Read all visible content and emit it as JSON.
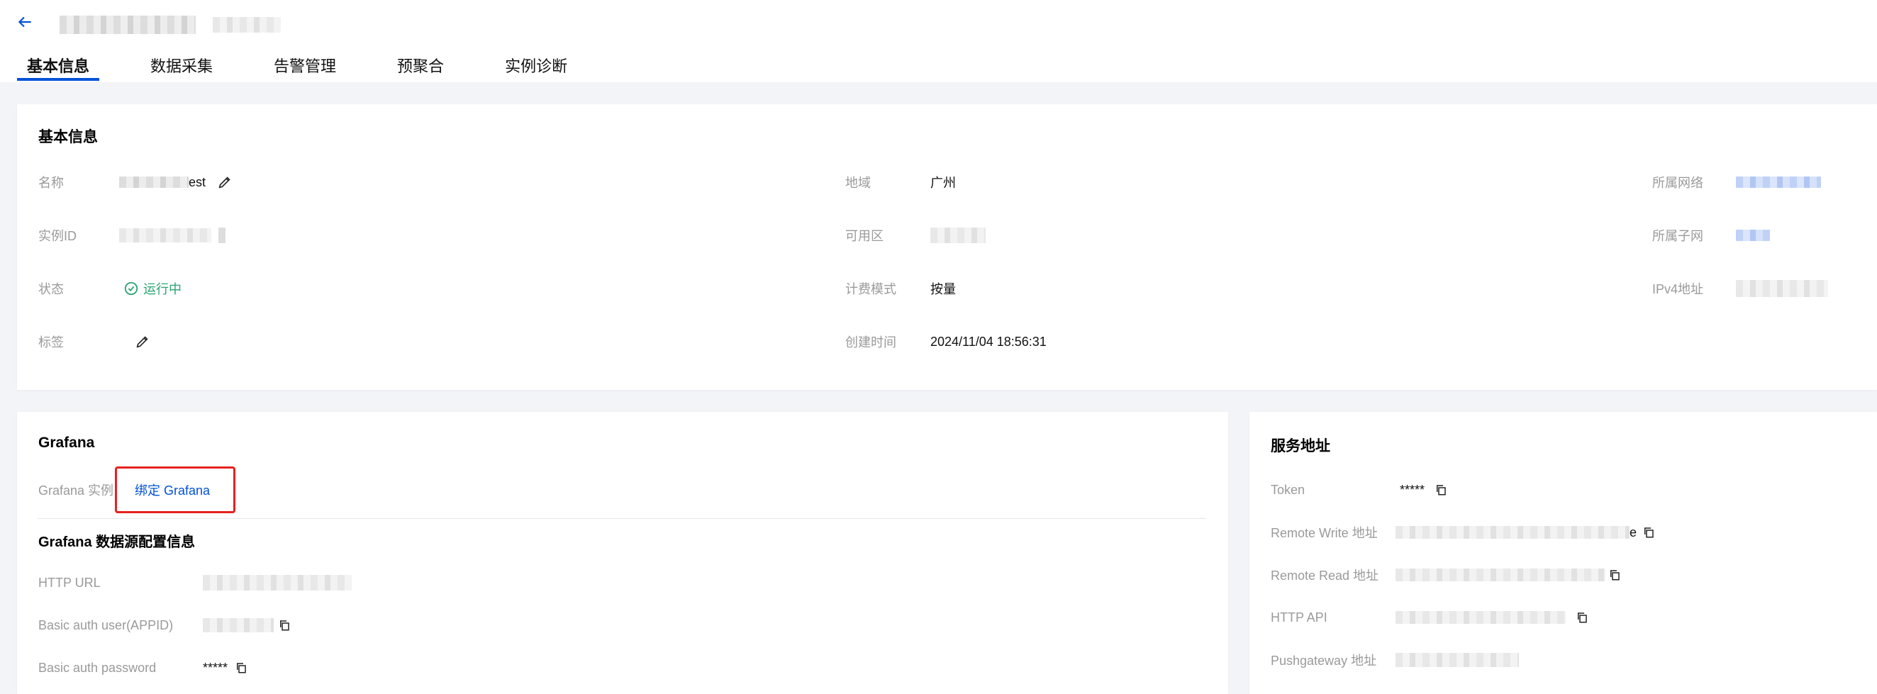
{
  "header": {
    "tabs": [
      {
        "label": "基本信息",
        "active": true
      },
      {
        "label": "数据采集"
      },
      {
        "label": "告警管理"
      },
      {
        "label": "预聚合"
      },
      {
        "label": "实例诊断"
      }
    ]
  },
  "basic": {
    "title": "基本信息",
    "name_label": "名称",
    "name_value_suffix": "est",
    "instance_id_label": "实例ID",
    "status_label": "状态",
    "status_value": "运行中",
    "tags_label": "标签",
    "region_label": "地域",
    "region_value": "广州",
    "zone_label": "可用区",
    "billing_label": "计费模式",
    "billing_value": "按量",
    "created_label": "创建时间",
    "created_value": "2024/11/04 18:56:31",
    "vpc_label": "所属网络",
    "subnet_label": "所属子网",
    "ipv4_label": "IPv4地址"
  },
  "grafana": {
    "title": "Grafana",
    "instance_label": "Grafana 实例",
    "bind_link": "绑定 Grafana",
    "ds_title": "Grafana 数据源配置信息",
    "http_url_label": "HTTP URL",
    "basic_user_label": "Basic auth user(APPID)",
    "basic_pwd_label": "Basic auth password",
    "basic_pwd_value": "*****"
  },
  "service": {
    "title": "服务地址",
    "token_label": "Token",
    "token_value": "*****",
    "remote_write_label": "Remote Write 地址",
    "remote_write_suffix": "e",
    "remote_read_label": "Remote Read 地址",
    "http_api_label": "HTTP API",
    "pushgateway_label": "Pushgateway 地址"
  },
  "colors": {
    "accent": "#0052d9",
    "success": "#2ba471",
    "highlight": "#e5221f"
  },
  "icons": [
    "back-arrow-icon",
    "edit-pencil-icon",
    "copy-icon",
    "check-circle-icon"
  ]
}
